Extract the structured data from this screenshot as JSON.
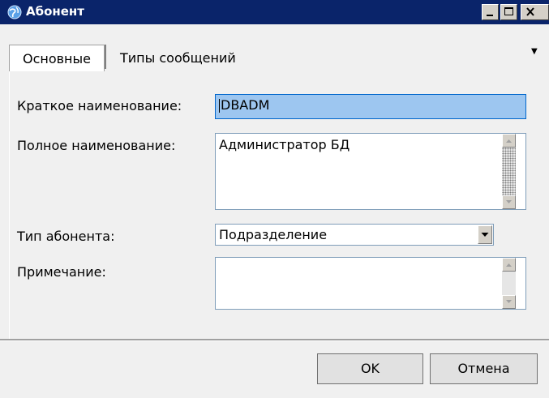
{
  "window": {
    "title": "Абонент"
  },
  "tabs": [
    {
      "label": "Основные",
      "active": true
    },
    {
      "label": "Типы сообщений",
      "active": false
    }
  ],
  "form": {
    "short_name_label": "Краткое наименование:",
    "short_name_value": "DBADM",
    "full_name_label": "Полное наименование:",
    "full_name_value": "Администратор БД",
    "type_label": "Тип абонента:",
    "type_value": "Подразделение",
    "note_label": "Примечание:",
    "note_value": ""
  },
  "buttons": {
    "ok": "OK",
    "cancel": "Отмена"
  },
  "colors": {
    "titlebar": "#0a246a",
    "selection": "#9dc6f0"
  }
}
